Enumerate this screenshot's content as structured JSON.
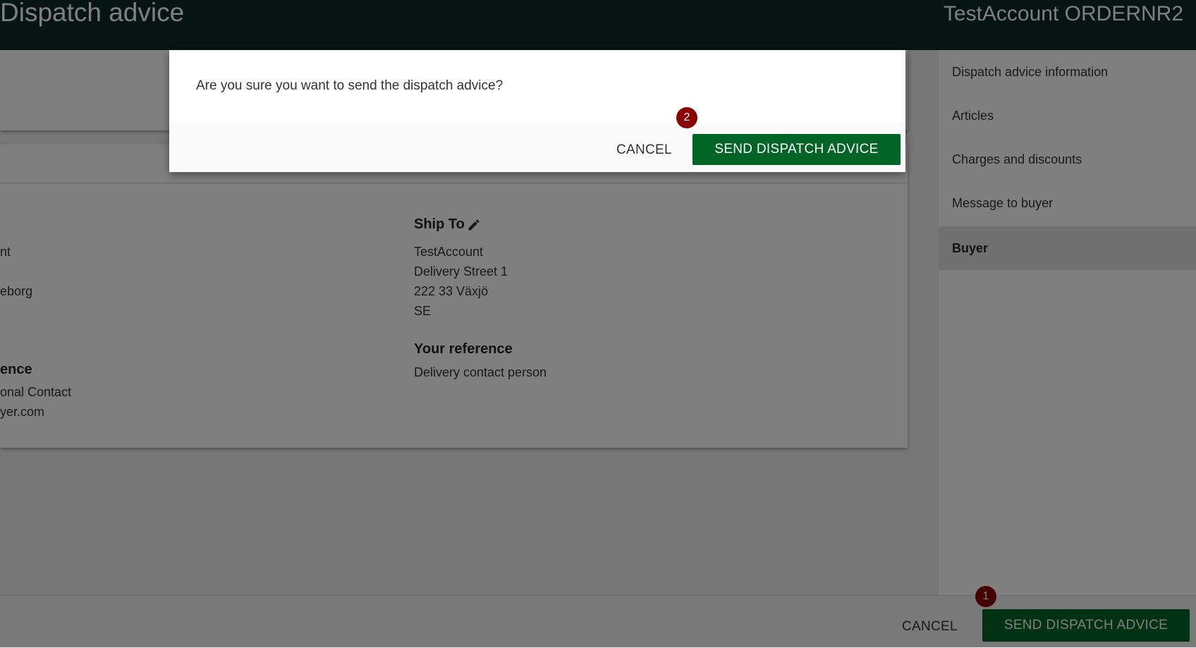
{
  "header": {
    "title": "Dispatch advice",
    "account": "TestAccount ORDERNR2"
  },
  "sidebar": {
    "items": [
      {
        "label": "Dispatch advice information"
      },
      {
        "label": "Articles"
      },
      {
        "label": "Charges and discounts"
      },
      {
        "label": "Message to buyer"
      },
      {
        "label": "Buyer"
      }
    ]
  },
  "buyer_card": {
    "left": {
      "line1": "nt",
      "line2": "eborg",
      "reference_heading": "ence",
      "ref_line1": "onal Contact",
      "ref_line2": "yer.com"
    },
    "ship_to": {
      "heading": "Ship To",
      "lines": [
        "TestAccount",
        "Delivery Street 1",
        "222 33 Växjö",
        "SE"
      ]
    },
    "your_reference": {
      "heading": "Your reference",
      "value": "Delivery contact person"
    }
  },
  "footer": {
    "cancel_label": "CANCEL",
    "send_label": "SEND DISPATCH ADVICE",
    "marker": "1"
  },
  "dialog": {
    "message": "Are you sure you want to send the dispatch advice?",
    "cancel_label": "CANCEL",
    "send_label": "SEND DISPATCH ADVICE",
    "marker": "2"
  },
  "colors": {
    "header_bg": "#0d2a23",
    "primary_button": "#006426",
    "marker": "#8b0000"
  },
  "icons": {
    "edit": "pencil-icon"
  }
}
